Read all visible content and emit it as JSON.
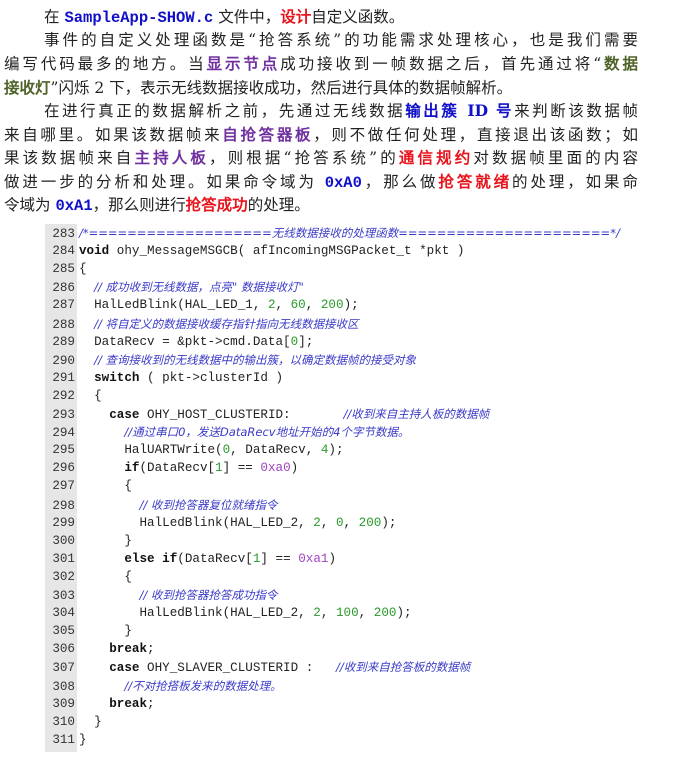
{
  "prose": [
    {
      "indent": true,
      "last": true,
      "segs": [
        {
          "t": "在 ",
          "s": "plain"
        },
        {
          "t": "SampleApp-SHOW.c",
          "s": "mono"
        },
        {
          "t": " 文件中，",
          "s": "plain"
        },
        {
          "t": "设计",
          "s": "red"
        },
        {
          "t": "自定义函数。",
          "s": "plain"
        }
      ]
    },
    {
      "indent": true,
      "last": false,
      "segs": [
        {
          "t": "事件的自定义处理函数是“抢答系统”的功能需求处理核心，也是我们需要",
          "s": "plain"
        }
      ]
    },
    {
      "indent": false,
      "last": false,
      "segs": [
        {
          "t": "编写代码最多的地方。当",
          "s": "plain"
        },
        {
          "t": "显示节点",
          "s": "purple"
        },
        {
          "t": "成功接收到一帧数据之后，首先通过将“",
          "s": "plain"
        },
        {
          "t": "数据",
          "s": "olive"
        }
      ]
    },
    {
      "indent": false,
      "last": true,
      "segs": [
        {
          "t": "接收灯",
          "s": "olive"
        },
        {
          "t": "”闪烁 2 下，表示无线数据接收成功，然后进行具体的数据帧解析。",
          "s": "plain"
        }
      ]
    },
    {
      "indent": true,
      "last": false,
      "segs": [
        {
          "t": "在进行真正的数据解析之前，先通过无线数据",
          "s": "plain"
        },
        {
          "t": "输出簇 ID 号",
          "s": "blue"
        },
        {
          "t": "来判断该数据帧",
          "s": "plain"
        }
      ]
    },
    {
      "indent": false,
      "last": false,
      "segs": [
        {
          "t": "来自哪里。如果该数据帧来",
          "s": "plain"
        },
        {
          "t": "自抢答器板",
          "s": "purple"
        },
        {
          "t": "，则不做任何处理，直接退出该函数；如",
          "s": "plain"
        }
      ]
    },
    {
      "indent": false,
      "last": false,
      "segs": [
        {
          "t": "果该数据帧来自",
          "s": "plain"
        },
        {
          "t": "主持人板",
          "s": "purple"
        },
        {
          "t": "，则根据“抢答系统”的",
          "s": "plain"
        },
        {
          "t": "通信规约",
          "s": "red"
        },
        {
          "t": "对数据帧里面的内容",
          "s": "plain"
        }
      ]
    },
    {
      "indent": false,
      "last": false,
      "segs": [
        {
          "t": "做进一步的分析和处理。如果命令域为 ",
          "s": "plain"
        },
        {
          "t": "0xA0",
          "s": "mono"
        },
        {
          "t": "，那么做",
          "s": "plain"
        },
        {
          "t": "抢答就绪",
          "s": "red"
        },
        {
          "t": "的处理，如果命",
          "s": "plain"
        }
      ]
    },
    {
      "indent": false,
      "last": true,
      "segs": [
        {
          "t": "令域为 ",
          "s": "plain"
        },
        {
          "t": "0xA1",
          "s": "mono"
        },
        {
          "t": "，那么则进行",
          "s": "plain"
        },
        {
          "t": "抢答成功",
          "s": "red"
        },
        {
          "t": "的处理。",
          "s": "plain"
        }
      ]
    }
  ],
  "code": {
    "lines": [
      {
        "n": "283",
        "segs": [
          {
            "t": "/*===================无线数据接收的处理函数======================*/",
            "k": "c"
          }
        ]
      },
      {
        "n": "284",
        "segs": [
          {
            "t": "void",
            "k": "k"
          },
          {
            "t": " ohy_MessageMSGCB( afIncomingMSGPacket_t *pkt )",
            "k": "p"
          }
        ]
      },
      {
        "n": "285",
        "segs": [
          {
            "t": "{",
            "k": "p"
          }
        ]
      },
      {
        "n": "286",
        "segs": [
          {
            "t": "  ",
            "k": "p"
          },
          {
            "t": "// 成功收到无线数据，点亮\" 数据接收灯\"",
            "k": "c"
          }
        ]
      },
      {
        "n": "287",
        "segs": [
          {
            "t": "  HalLedBlink(HAL_LED_1, ",
            "k": "p"
          },
          {
            "t": "2",
            "k": "n"
          },
          {
            "t": ", ",
            "k": "p"
          },
          {
            "t": "60",
            "k": "n"
          },
          {
            "t": ", ",
            "k": "p"
          },
          {
            "t": "200",
            "k": "n"
          },
          {
            "t": ");",
            "k": "p"
          }
        ]
      },
      {
        "n": "288",
        "segs": [
          {
            "t": "  ",
            "k": "p"
          },
          {
            "t": "// 将自定义的数据接收缓存指针指向无线数据接收区",
            "k": "c"
          }
        ]
      },
      {
        "n": "289",
        "segs": [
          {
            "t": "  DataRecv = &pkt->cmd.Data[",
            "k": "p"
          },
          {
            "t": "0",
            "k": "n"
          },
          {
            "t": "];",
            "k": "p"
          }
        ]
      },
      {
        "n": "290",
        "segs": [
          {
            "t": "  ",
            "k": "p"
          },
          {
            "t": "// 查询接收到的无线数据中的输出簇，以确定数据帧的接受对象",
            "k": "c"
          }
        ]
      },
      {
        "n": "291",
        "segs": [
          {
            "t": "  ",
            "k": "p"
          },
          {
            "t": "switch",
            "k": "k"
          },
          {
            "t": " ( pkt->clusterId )",
            "k": "p"
          }
        ]
      },
      {
        "n": "292",
        "segs": [
          {
            "t": "  {",
            "k": "p"
          }
        ]
      },
      {
        "n": "293",
        "segs": [
          {
            "t": "    ",
            "k": "p"
          },
          {
            "t": "case",
            "k": "k"
          },
          {
            "t": " OHY_HOST_CLUSTERID:       ",
            "k": "p"
          },
          {
            "t": "//收到来自主持人板的数据帧",
            "k": "c"
          }
        ]
      },
      {
        "n": "294",
        "segs": [
          {
            "t": "      ",
            "k": "p"
          },
          {
            "t": "//通过串口0，发送DataRecv地址开始的4个字节数据。",
            "k": "c"
          }
        ]
      },
      {
        "n": "295",
        "segs": [
          {
            "t": "      HalUARTWrite(",
            "k": "p"
          },
          {
            "t": "0",
            "k": "n"
          },
          {
            "t": ", DataRecv, ",
            "k": "p"
          },
          {
            "t": "4",
            "k": "n"
          },
          {
            "t": ");",
            "k": "p"
          }
        ]
      },
      {
        "n": "296",
        "segs": [
          {
            "t": "      ",
            "k": "p"
          },
          {
            "t": "if",
            "k": "k"
          },
          {
            "t": "(DataRecv[",
            "k": "p"
          },
          {
            "t": "1",
            "k": "n"
          },
          {
            "t": "] == ",
            "k": "p"
          },
          {
            "t": "0xa0",
            "k": "h"
          },
          {
            "t": ")",
            "k": "p"
          }
        ]
      },
      {
        "n": "297",
        "segs": [
          {
            "t": "      {",
            "k": "p"
          }
        ]
      },
      {
        "n": "298",
        "segs": [
          {
            "t": "        ",
            "k": "p"
          },
          {
            "t": "// 收到抢答器复位就绪指令",
            "k": "c"
          }
        ]
      },
      {
        "n": "299",
        "segs": [
          {
            "t": "        HalLedBlink(HAL_LED_2, ",
            "k": "p"
          },
          {
            "t": "2",
            "k": "n"
          },
          {
            "t": ", ",
            "k": "p"
          },
          {
            "t": "0",
            "k": "n"
          },
          {
            "t": ", ",
            "k": "p"
          },
          {
            "t": "200",
            "k": "n"
          },
          {
            "t": ");",
            "k": "p"
          }
        ]
      },
      {
        "n": "300",
        "segs": [
          {
            "t": "      }",
            "k": "p"
          }
        ]
      },
      {
        "n": "301",
        "segs": [
          {
            "t": "      ",
            "k": "p"
          },
          {
            "t": "else if",
            "k": "k"
          },
          {
            "t": "(DataRecv[",
            "k": "p"
          },
          {
            "t": "1",
            "k": "n"
          },
          {
            "t": "] == ",
            "k": "p"
          },
          {
            "t": "0xa1",
            "k": "h"
          },
          {
            "t": ")",
            "k": "p"
          }
        ]
      },
      {
        "n": "302",
        "segs": [
          {
            "t": "      {",
            "k": "p"
          }
        ]
      },
      {
        "n": "303",
        "segs": [
          {
            "t": "        ",
            "k": "p"
          },
          {
            "t": "// 收到抢答器抢答成功指令",
            "k": "c"
          }
        ]
      },
      {
        "n": "304",
        "segs": [
          {
            "t": "        HalLedBlink(HAL_LED_2, ",
            "k": "p"
          },
          {
            "t": "2",
            "k": "n"
          },
          {
            "t": ", ",
            "k": "p"
          },
          {
            "t": "100",
            "k": "n"
          },
          {
            "t": ", ",
            "k": "p"
          },
          {
            "t": "200",
            "k": "n"
          },
          {
            "t": ");",
            "k": "p"
          }
        ]
      },
      {
        "n": "305",
        "segs": [
          {
            "t": "      }",
            "k": "p"
          }
        ]
      },
      {
        "n": "306",
        "segs": [
          {
            "t": "    ",
            "k": "p"
          },
          {
            "t": "break",
            "k": "k"
          },
          {
            "t": ";",
            "k": "p"
          }
        ]
      },
      {
        "n": "307",
        "segs": [
          {
            "t": "    ",
            "k": "p"
          },
          {
            "t": "case",
            "k": "k"
          },
          {
            "t": " OHY_SLAVER_CLUSTERID :   ",
            "k": "p"
          },
          {
            "t": "//收到来自抢答板的数据帧",
            "k": "c"
          }
        ]
      },
      {
        "n": "308",
        "segs": [
          {
            "t": "      ",
            "k": "p"
          },
          {
            "t": "//不对抢搭板发来的数据处理。",
            "k": "c"
          }
        ]
      },
      {
        "n": "309",
        "segs": [
          {
            "t": "    ",
            "k": "p"
          },
          {
            "t": "break",
            "k": "k"
          },
          {
            "t": ";",
            "k": "p"
          }
        ]
      },
      {
        "n": "310",
        "segs": [
          {
            "t": "  }",
            "k": "p"
          }
        ]
      },
      {
        "n": "311",
        "segs": [
          {
            "t": "}",
            "k": "p"
          }
        ]
      }
    ]
  }
}
